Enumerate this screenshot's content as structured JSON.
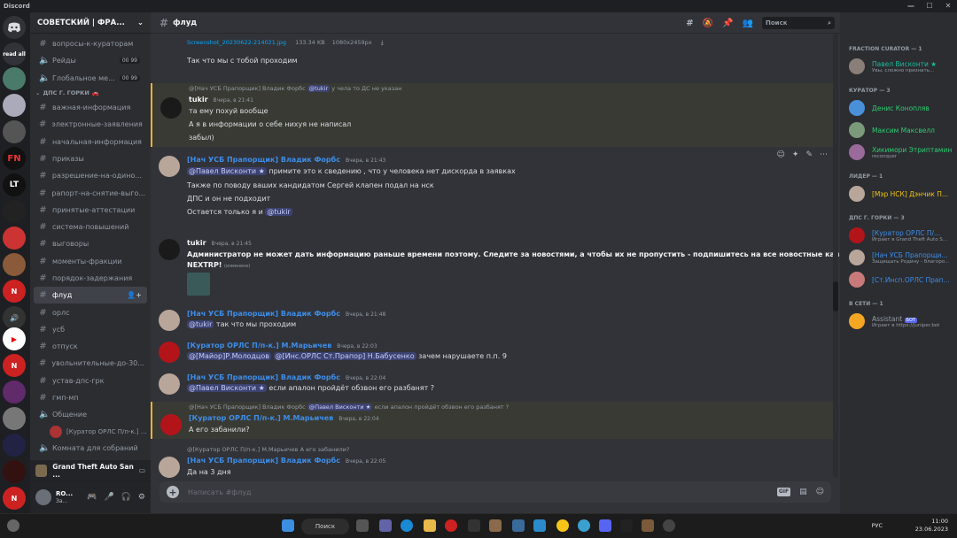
{
  "window": {
    "title": "Discord"
  },
  "servers": {
    "readall_label": "read all"
  },
  "guild": {
    "name": "СОВЕТСКИЙ | ФРА..."
  },
  "channels": [
    {
      "type": "text",
      "label": "вопросы-к-кураторам"
    },
    {
      "type": "voice",
      "label": "Рейды",
      "badge": "00 99"
    },
    {
      "type": "voice",
      "label": "Глобальное ме...",
      "badge": "00 99"
    },
    {
      "type": "category",
      "label": "ДПС Г. ГОРКИ"
    },
    {
      "type": "text",
      "label": "важная-информация"
    },
    {
      "type": "text",
      "label": "электронные-заявления"
    },
    {
      "type": "text",
      "label": "начальная-информация"
    },
    {
      "type": "text",
      "label": "приказы"
    },
    {
      "type": "text",
      "label": "разрешение-на-одино..."
    },
    {
      "type": "text",
      "label": "рапорт-на-снятие-выго..."
    },
    {
      "type": "text",
      "label": "принятые-аттестации"
    },
    {
      "type": "text",
      "label": "система-повышений"
    },
    {
      "type": "text",
      "label": "выговоры"
    },
    {
      "type": "text",
      "label": "моменты-фракции"
    },
    {
      "type": "text",
      "label": "порядок-задержания"
    },
    {
      "type": "text",
      "label": "флуд",
      "active": true
    },
    {
      "type": "text",
      "label": "орлс"
    },
    {
      "type": "text",
      "label": "усб"
    },
    {
      "type": "text",
      "label": "отпуск"
    },
    {
      "type": "text",
      "label": "увольнительные-до-30..."
    },
    {
      "type": "text",
      "label": "устав-дпс-грк"
    },
    {
      "type": "text",
      "label": "гмп-мп"
    },
    {
      "type": "voice",
      "label": "Общение"
    },
    {
      "type": "voiceuser",
      "label": "[Куратор ОРЛС П/п-к.] ..."
    },
    {
      "type": "voice",
      "label": "Комната для собраний"
    }
  ],
  "activity": {
    "label": "Grand Theft Auto San ..."
  },
  "user": {
    "name": "RO...",
    "status": "За..."
  },
  "chat": {
    "channel": "флуд",
    "search_placeholder": "Поиск",
    "composer_placeholder": "Написать #флуд",
    "gif_label": "GIF",
    "attachment": {
      "name": "Screenshot_20230622-214021.jpg",
      "size": "133.34 KB",
      "dims": "1080x2459px"
    },
    "messages": [
      {
        "text": "Так что мы с тобой проходим"
      },
      {
        "reply": "@[Нач УСБ Прапорщик] Владик Форбс",
        "reply_mention": "@tukir",
        "reply_text": "у чела то ДС не указан",
        "author": "tukir",
        "time": "Вчера, в 21:41",
        "lines": [
          "та ему похуй вообще",
          "А я в информации о себе нихуя не написал",
          "забыл)"
        ]
      },
      {
        "author": "[Нач УСБ Прапорщик] Владик Форбс",
        "time": "Вчера, в 21:43",
        "mention": "@Павел Висконти ★",
        "line1": "примите это к сведению , что у человека нет дискорда в заявках",
        "lines": [
          "Также по поводу ваших кандидатом Сергей клапен подал на нск",
          "ДПС и он не подходит",
          "Остается только я и"
        ],
        "mention2": "@tukir"
      },
      {
        "author": "tukir",
        "time": "Вчера, в 21:45",
        "lines": [
          "Администратор не может дать информацию раньше времени поэтому. Следите за новостями, а чтобы их не пропустить - подпишитесь на все новостные каналы",
          "NEXTRP!"
        ],
        "edited": "(изменено)"
      },
      {
        "author": "[Нач УСБ Прапорщик] Владик Форбс",
        "time": "Вчера, в 21:48",
        "mention": "@tukir",
        "text": "так что мы проходим"
      },
      {
        "author": "[Куратор ОРЛС П/п-к.] М.Марьичев",
        "time": "Вчера, в 22:03",
        "mention": "@[Майор]Р.Молодцов",
        "mention2": "@[Инс.ОРЛС Ст.Прапор] Н.Бабусенко",
        "text": "зачем нарушаете п.п. 9"
      },
      {
        "author": "[Нач УСБ Прапорщик] Владик Форбс",
        "time": "Вчера, в 22:04",
        "mention": "@Павел Висконти ★",
        "text": "если апалон пройдёт обзвон его разбанят ?"
      },
      {
        "reply": "@[Нач УСБ Прапорщик] Владик Форбс",
        "reply_mention": "@Павел Висконти ★",
        "reply_text": "если апалон пройдёт обзвон его разбанят ?",
        "author": "[Куратор ОРЛС П/п-к.] М.Марьичев",
        "time": "Вчера, в 22:04",
        "text": "А его забанили?"
      },
      {
        "reply": "@[Куратор ОРЛС П/п-к.] М.Марьичев",
        "reply_text": "А его забанили?",
        "author": "[Нач УСБ Прапорщик] Владик Форбс",
        "time": "Вчера, в 22:05",
        "text": "Да на 3 дня"
      }
    ]
  },
  "members": {
    "groups": [
      {
        "title": "FRACTION CURATOR — 1",
        "members": [
          {
            "name": "Павел Висконти ★",
            "status": "Увы, сложно признать...",
            "color": "#1abc9c"
          }
        ]
      },
      {
        "title": "КУРАТОР — 3",
        "members": [
          {
            "name": "Денис Конопляв",
            "status": "",
            "color": "#2ecc71"
          },
          {
            "name": "Максим Максвелл",
            "status": "",
            "color": "#2ecc71"
          },
          {
            "name": "Хикимори Этриптамин",
            "status": "reconquer",
            "color": "#2ecc71"
          }
        ]
      },
      {
        "title": "ЛИДЕР — 1",
        "members": [
          {
            "name": "[Мэр НСК] Дэнчик П...",
            "status": "",
            "color": "#f1c40f"
          }
        ]
      },
      {
        "title": "ДПС Г. ГОРКИ — 3",
        "members": [
          {
            "name": "[Куратор ОРЛС П/...",
            "status": "Играет в Grand Theft Auto S...",
            "color": "#3e8de8"
          },
          {
            "name": "[Нач УСБ Прапорщи...",
            "status": "Защищать Родину - благоро...",
            "color": "#3e8de8"
          },
          {
            "name": "[Ст.Инсп.ОРЛС Прап...",
            "status": "",
            "color": "#3e8de8"
          }
        ]
      },
      {
        "title": "В СЕТИ — 1",
        "members": [
          {
            "name": "Assistant",
            "badge": "БОТ",
            "status": "Играет в https://juniper.bot",
            "color": "#949ba4"
          }
        ]
      }
    ]
  },
  "taskbar": {
    "search_label": "Поиск",
    "lang": "РУС",
    "time": "11:00",
    "date": "23.06.2023"
  }
}
